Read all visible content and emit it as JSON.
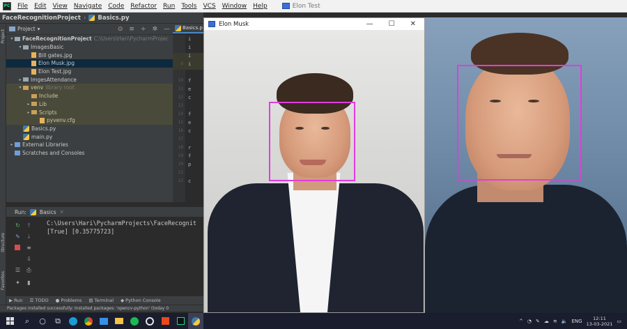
{
  "menubar": {
    "items": [
      "File",
      "Edit",
      "View",
      "Navigate",
      "Code",
      "Refactor",
      "Run",
      "Tools",
      "VCS",
      "Window",
      "Help"
    ],
    "task_title": "Elon Test"
  },
  "breadcrumb": {
    "project": "FaceRecognitionProject",
    "file": "Basics.py"
  },
  "project_panel": {
    "header_label": "Project",
    "tree": [
      {
        "label": "FaceRecognitionProject",
        "path": "C:\\Users\\Hari\\PycharmProjec",
        "indent": 0,
        "kind": "root"
      },
      {
        "label": "ImagesBasic",
        "indent": 1,
        "kind": "dir"
      },
      {
        "label": "Bill gates.jpg",
        "indent": 2,
        "kind": "file"
      },
      {
        "label": "Elon Musk.jpg",
        "indent": 2,
        "kind": "file",
        "selected": true
      },
      {
        "label": "Elon Test.jpg",
        "indent": 2,
        "kind": "file"
      },
      {
        "label": "ImgesAttendance",
        "indent": 1,
        "kind": "dir-closed"
      },
      {
        "label": "venv",
        "path": "library root",
        "indent": 1,
        "kind": "venv"
      },
      {
        "label": "Include",
        "indent": 2,
        "kind": "venv-dir"
      },
      {
        "label": "Lib",
        "indent": 2,
        "kind": "venv-dir"
      },
      {
        "label": "Scripts",
        "indent": 2,
        "kind": "venv-dir"
      },
      {
        "label": "pyvenv.cfg",
        "indent": 3,
        "kind": "venv-file"
      },
      {
        "label": "Basics.py",
        "indent": 1,
        "kind": "py"
      },
      {
        "label": "main.py",
        "indent": 1,
        "kind": "py"
      },
      {
        "label": "External Libraries",
        "indent": 0,
        "kind": "lib"
      },
      {
        "label": "Scratches and Consoles",
        "indent": 0,
        "kind": "scratch"
      }
    ]
  },
  "editor": {
    "tab_label": "Basics.p",
    "lines": [
      {
        "num": "",
        "code": "i"
      },
      {
        "num": "",
        "code": "i"
      },
      {
        "num": "",
        "code": "i"
      },
      {
        "num": "8",
        "code": "i"
      },
      {
        "num": "",
        "code": ""
      },
      {
        "num": "10",
        "code": "f"
      },
      {
        "num": "11",
        "code": "e"
      },
      {
        "num": "12",
        "code": "c"
      },
      {
        "num": "13",
        "code": ""
      },
      {
        "num": "14",
        "code": "f"
      },
      {
        "num": "15",
        "code": "e"
      },
      {
        "num": "16",
        "code": "c"
      },
      {
        "num": "17",
        "code": ""
      },
      {
        "num": "18",
        "code": "r"
      },
      {
        "num": "19",
        "code": "f"
      },
      {
        "num": "20",
        "code": "p"
      },
      {
        "num": "21",
        "code": ""
      },
      {
        "num": "22",
        "code": "c"
      }
    ]
  },
  "run_panel": {
    "label": "Run:",
    "config": "Basics",
    "output_line1": "C:\\Users\\Hari\\PycharmProjects\\FaceRecognit",
    "output_line2": "[True] [0.35775723]"
  },
  "bottom_tools": [
    "Run",
    "TODO",
    "Problems",
    "Terminal",
    "Python Console"
  ],
  "statusbar": "Packages installed successfully: Installed packages: 'opencv-python' (today 0",
  "cv_window": {
    "title": "Elon Musk",
    "minimize": "—",
    "maximize": "☐",
    "close": "✕"
  },
  "taskbar": {
    "tray_lang": "ENG",
    "time": "12:11",
    "date": "13-03-2021"
  },
  "colors": {
    "face_box": "#e23be0",
    "ide_bg": "#2b2b2b",
    "taskbar": "#1a1d2e"
  }
}
